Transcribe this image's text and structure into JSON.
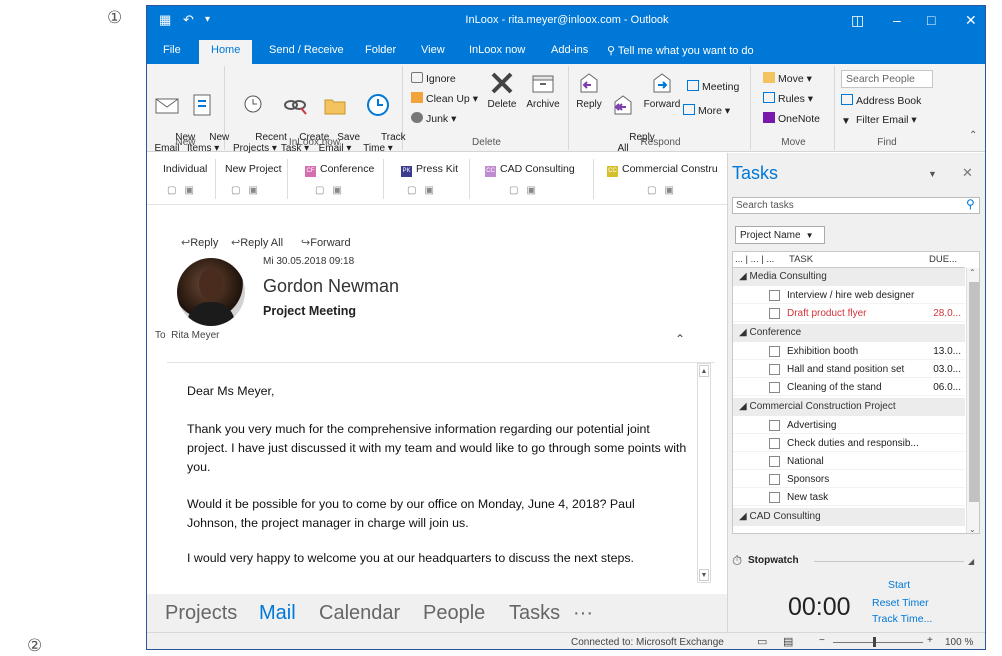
{
  "markers": {
    "one": "①",
    "two": "②"
  },
  "window": {
    "title": "InLoox - rita.meyer@inloox.com - Outlook",
    "tabs": [
      "File",
      "Home",
      "Send / Receive",
      "Folder",
      "View",
      "InLoox now",
      "Add-ins"
    ],
    "tell_me": "Tell me what you want to do"
  },
  "ribbon": {
    "new": {
      "new_email": "New\nEmail",
      "new_items": "New\nItems ▾",
      "label": "New"
    },
    "inloox": {
      "recent": "Recent\nProjects ▾",
      "create": "Create\nTask ▾",
      "save": "Save\nEmail ▾",
      "track": "Track\nTime ▾",
      "label": "InLoox now"
    },
    "delete": {
      "ignore": "Ignore",
      "cleanup": "Clean Up ▾",
      "junk": "Junk ▾",
      "delete": "Delete",
      "archive": "Archive",
      "label": "Delete"
    },
    "respond": {
      "reply": "Reply",
      "reply_all": "Reply\nAll",
      "forward": "Forward",
      "meeting": "Meeting",
      "more": "More ▾",
      "label": "Respond"
    },
    "move": {
      "move": "Move ▾",
      "rules": "Rules ▾",
      "onenote": "OneNote",
      "label": "Move"
    },
    "find": {
      "search_people": "Search People",
      "address_book": "Address Book",
      "filter_email": "Filter Email ▾",
      "label": "Find"
    }
  },
  "projects": [
    {
      "name": "Individual",
      "badge": "",
      "color": ""
    },
    {
      "name": "New Project",
      "badge": "",
      "color": ""
    },
    {
      "name": "Conference",
      "badge": "CF",
      "color": "#d66fb0"
    },
    {
      "name": "Press Kit",
      "badge": "PK",
      "color": "#3b3b8f"
    },
    {
      "name": "CAD Consulting",
      "badge": "CC",
      "color": "#c08cd0"
    },
    {
      "name": "Commercial Constru",
      "badge": "CC",
      "color": "#d4c02a"
    }
  ],
  "mail": {
    "reply": "Reply",
    "reply_all": "Reply All",
    "forward": "Forward",
    "date": "Mi 30.05.2018 09:18",
    "sender": "Gordon Newman",
    "subject": "Project Meeting",
    "to_label": "To",
    "to_name": "Rita Meyer",
    "body": [
      "Dear Ms Meyer,",
      "Thank you very much for the comprehensive information regarding our potential joint project. I have just discussed it with my team and would like to go through some points with you.",
      "Would it be possible for you to come by our office on Monday, June 4, 2018? Paul Johnson, the project manager in charge will join us.",
      "I would very happy to welcome you at our headquarters to discuss the next steps."
    ]
  },
  "nav": {
    "projects": "Projects",
    "mail": "Mail",
    "calendar": "Calendar",
    "people": "People",
    "tasks": "Tasks",
    "more": "···"
  },
  "status": {
    "connection": "Connected to: Microsoft Exchange",
    "zoom": "100 %"
  },
  "tasks_pane": {
    "title": "Tasks",
    "search_placeholder": "Search tasks",
    "group_by": "Project Name",
    "col_task": "TASK",
    "col_due": "DUE...",
    "groups": [
      {
        "name": "Media Consulting",
        "tasks": [
          {
            "name": "Interview / hire web designer",
            "due": "",
            "overdue": false
          },
          {
            "name": "Draft product flyer",
            "due": "28.0...",
            "overdue": true
          }
        ]
      },
      {
        "name": "Conference",
        "tasks": [
          {
            "name": "Exhibition booth",
            "due": "13.0...",
            "overdue": false
          },
          {
            "name": "Hall and stand position set",
            "due": "03.0...",
            "overdue": false
          },
          {
            "name": "Cleaning of the stand",
            "due": "06.0...",
            "overdue": false
          }
        ]
      },
      {
        "name": "Commercial Construction Project",
        "tasks": [
          {
            "name": "Advertising",
            "due": "",
            "overdue": false
          },
          {
            "name": "Check duties and responsib...",
            "due": "",
            "overdue": false
          },
          {
            "name": "National",
            "due": "",
            "overdue": false
          },
          {
            "name": "Sponsors",
            "due": "",
            "overdue": false
          },
          {
            "name": "New task",
            "due": "",
            "overdue": false
          }
        ]
      },
      {
        "name": "CAD Consulting",
        "tasks": []
      }
    ],
    "stopwatch": {
      "title": "Stopwatch",
      "time": "00:00",
      "start": "Start",
      "reset": "Reset Timer",
      "track": "Track Time..."
    }
  }
}
